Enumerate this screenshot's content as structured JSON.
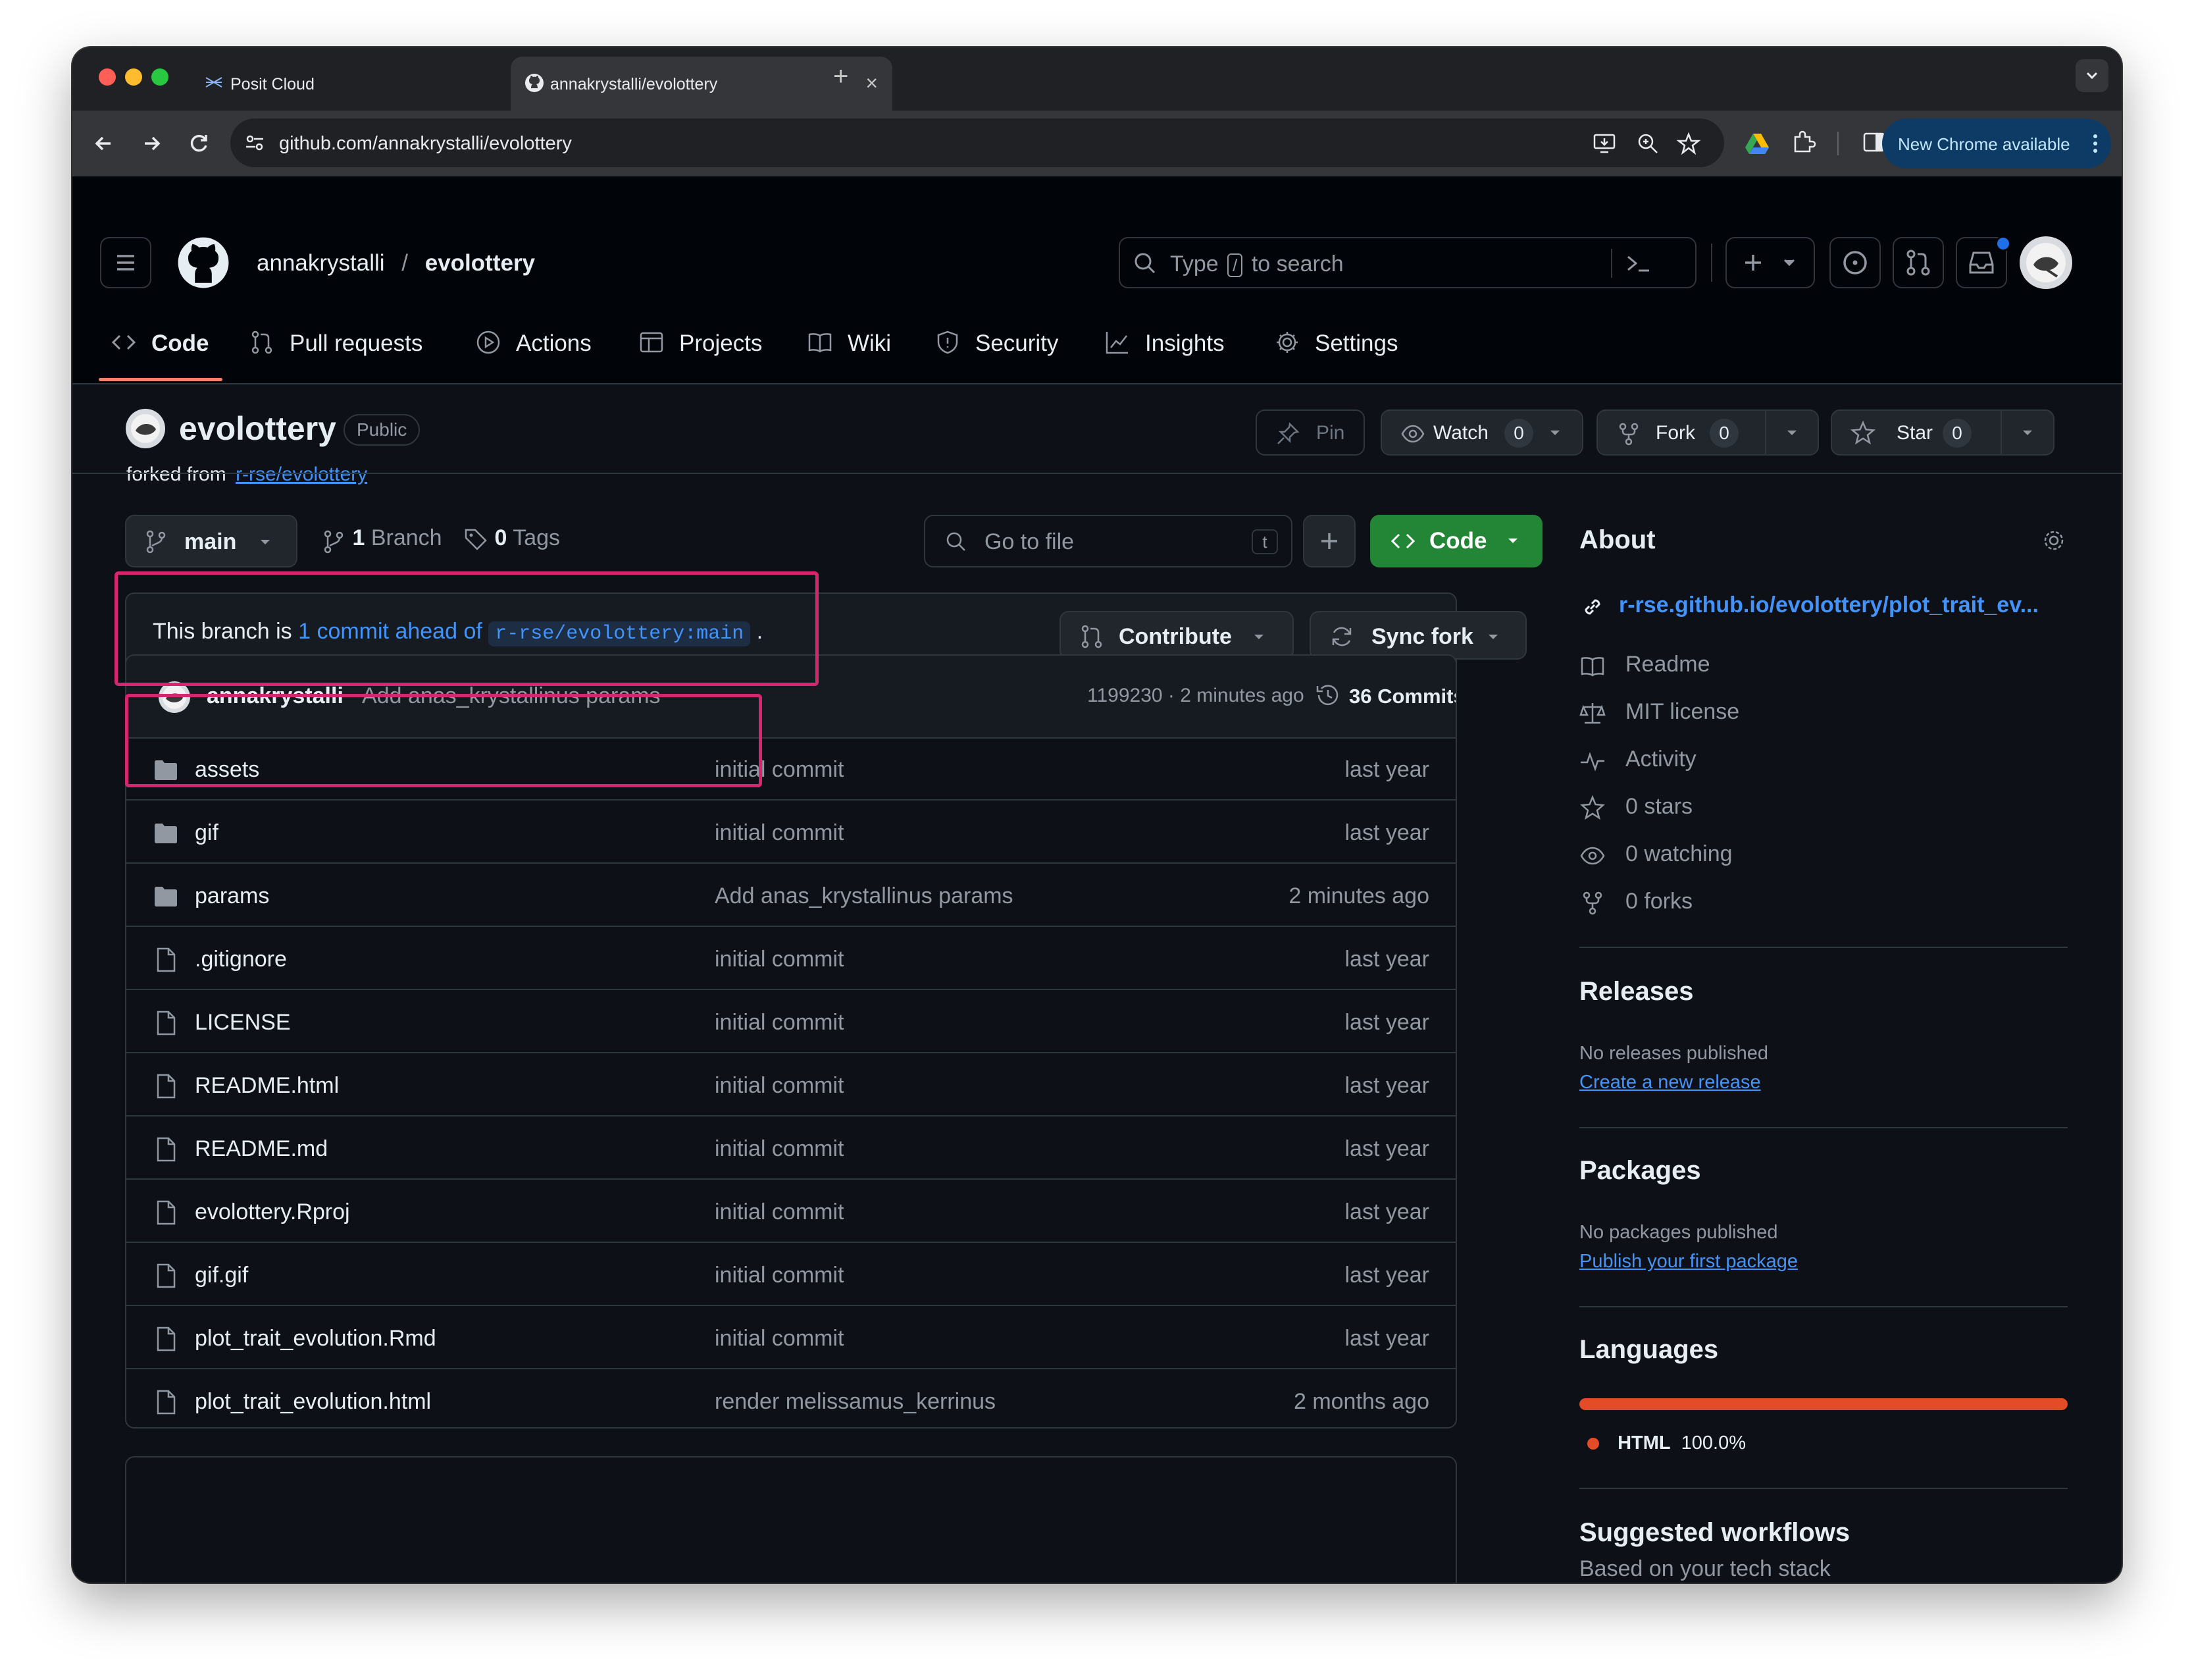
{
  "browser": {
    "tabs": [
      {
        "title": "Posit Cloud"
      },
      {
        "title": "annakrystalli/evolottery"
      }
    ],
    "url": "github.com/annakrystalli/evolottery",
    "update_label": "New Chrome available"
  },
  "header": {
    "owner": "annakrystalli",
    "separator": "/",
    "repo": "evolottery",
    "search_placeholder_prefix": "Type",
    "search_key": "/",
    "search_placeholder_suffix": "to search"
  },
  "repo_nav": [
    {
      "label": "Code",
      "icon": "code-icon",
      "active": true
    },
    {
      "label": "Pull requests",
      "icon": "pull-request-icon"
    },
    {
      "label": "Actions",
      "icon": "play-icon"
    },
    {
      "label": "Projects",
      "icon": "table-icon"
    },
    {
      "label": "Wiki",
      "icon": "book-icon"
    },
    {
      "label": "Security",
      "icon": "shield-icon"
    },
    {
      "label": "Insights",
      "icon": "graph-icon"
    },
    {
      "label": "Settings",
      "icon": "gear-icon"
    }
  ],
  "repo": {
    "name": "evolottery",
    "visibility": "Public",
    "forked_from_prefix": "forked from",
    "forked_from": "r-rse/evolottery",
    "pin_label": "Pin",
    "watch_label": "Watch",
    "watch_count": "0",
    "fork_label": "Fork",
    "fork_count": "0",
    "star_label": "Star",
    "star_count": "0"
  },
  "branchbar": {
    "branch": "main",
    "branch_count": "1",
    "branch_label": "Branch",
    "tag_count": "0",
    "tag_label": "Tags",
    "goto_placeholder": "Go to file",
    "goto_key": "t",
    "code_label": "Code"
  },
  "ahead": {
    "prefix": "This branch is",
    "link": "1 commit ahead of",
    "ref": "r-rse/evolottery:main",
    "suffix": ".",
    "contribute_label": "Contribute",
    "sync_label": "Sync fork"
  },
  "latest_commit": {
    "author": "annakrystalli",
    "message": "Add anas_krystallinus params",
    "meta": "1199230 · 2 minutes ago",
    "commits_label": "36 Commits"
  },
  "files": [
    {
      "name": "assets",
      "type": "folder",
      "message": "initial commit",
      "date": "last year"
    },
    {
      "name": "gif",
      "type": "folder",
      "message": "initial commit",
      "date": "last year"
    },
    {
      "name": "params",
      "type": "folder",
      "message": "Add anas_krystallinus params",
      "date": "2 minutes ago"
    },
    {
      "name": ".gitignore",
      "type": "file",
      "message": "initial commit",
      "date": "last year"
    },
    {
      "name": "LICENSE",
      "type": "file",
      "message": "initial commit",
      "date": "last year"
    },
    {
      "name": "README.html",
      "type": "file",
      "message": "initial commit",
      "date": "last year"
    },
    {
      "name": "README.md",
      "type": "file",
      "message": "initial commit",
      "date": "last year"
    },
    {
      "name": "evolottery.Rproj",
      "type": "file",
      "message": "initial commit",
      "date": "last year"
    },
    {
      "name": "gif.gif",
      "type": "file",
      "message": "initial commit",
      "date": "last year"
    },
    {
      "name": "plot_trait_evolution.Rmd",
      "type": "file",
      "message": "initial commit",
      "date": "last year"
    },
    {
      "name": "plot_trait_evolution.html",
      "type": "file",
      "message": "render melissamus_kerrinus",
      "date": "2 months ago"
    }
  ],
  "about": {
    "title": "About",
    "website": "r-rse.github.io/evolottery/plot_trait_ev...",
    "items": [
      {
        "icon": "book-icon",
        "label": "Readme"
      },
      {
        "icon": "scale-icon",
        "label": "MIT license"
      },
      {
        "icon": "pulse-icon",
        "label": "Activity"
      },
      {
        "icon": "star-icon",
        "label": "0 stars"
      },
      {
        "icon": "eye-icon",
        "label": "0 watching"
      },
      {
        "icon": "fork-icon",
        "label": "0 forks"
      }
    ]
  },
  "releases": {
    "title": "Releases",
    "empty": "No releases published",
    "action": "Create a new release"
  },
  "packages": {
    "title": "Packages",
    "empty": "No packages published",
    "action": "Publish your first package"
  },
  "languages": {
    "title": "Languages",
    "items": [
      {
        "name": "HTML",
        "percent": "100.0%",
        "color": "#e34c26",
        "share": 1.0
      }
    ]
  },
  "workflows": {
    "title": "Suggested workflows",
    "subtitle": "Based on your tech stack"
  },
  "colors": {
    "bg": "#0d1117",
    "header_bg": "#010409",
    "border": "#30363d",
    "link": "#4493f8",
    "primary_button": "#238636",
    "highlight": "#d6266f",
    "nav_underline": "#f78166"
  }
}
